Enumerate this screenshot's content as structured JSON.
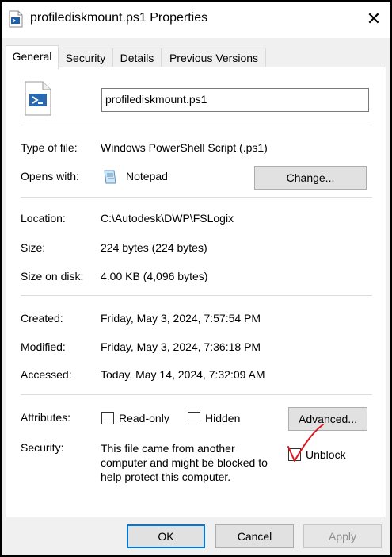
{
  "window": {
    "title": "profilediskmount.ps1 Properties",
    "close_glyph": "✕"
  },
  "tabs": [
    {
      "label": "General",
      "active": true
    },
    {
      "label": "Security",
      "active": false
    },
    {
      "label": "Details",
      "active": false
    },
    {
      "label": "Previous Versions",
      "active": false
    }
  ],
  "general": {
    "filename": "profilediskmount.ps1",
    "type_label": "Type of file:",
    "type_value": "Windows PowerShell Script (.ps1)",
    "opens_label": "Opens with:",
    "opens_value": "Notepad",
    "change_button": "Change...",
    "location_label": "Location:",
    "location_value": "C:\\Autodesk\\DWP\\FSLogix",
    "size_label": "Size:",
    "size_value": "224 bytes (224 bytes)",
    "size_on_disk_label": "Size on disk:",
    "size_on_disk_value": "4.00 KB (4,096 bytes)",
    "created_label": "Created:",
    "created_value": "Friday, May 3, 2024, 7:57:54 PM",
    "modified_label": "Modified:",
    "modified_value": "Friday, May 3, 2024, 7:36:18 PM",
    "accessed_label": "Accessed:",
    "accessed_value": "Today, May 14, 2024, 7:32:09 AM",
    "attributes_label": "Attributes:",
    "readonly_label": "Read-only",
    "readonly_checked": false,
    "hidden_label": "Hidden",
    "hidden_checked": false,
    "advanced_button": "Advanced...",
    "security_label": "Security:",
    "security_text_1": "This file came from another",
    "security_text_2": "computer and might be blocked to",
    "security_text_3": "help protect this computer.",
    "unblock_label": "Unblock",
    "unblock_checked": true
  },
  "footer": {
    "ok": "OK",
    "cancel": "Cancel",
    "apply": "Apply"
  },
  "colors": {
    "annotation_red": "#e0141e",
    "focus_blue": "#0078d7"
  }
}
